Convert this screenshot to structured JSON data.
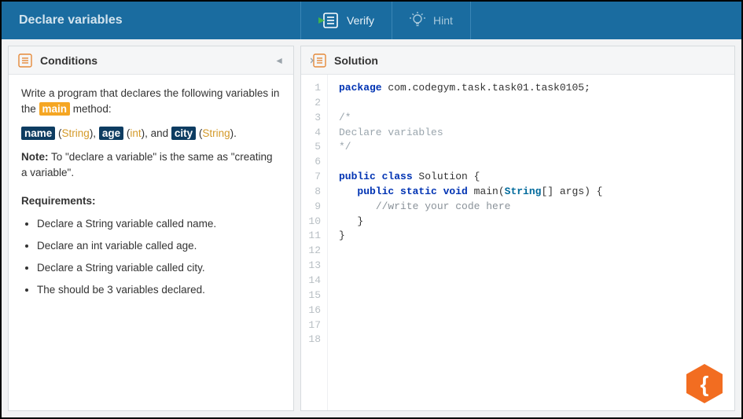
{
  "header": {
    "title": "Declare variables",
    "verify_label": "Verify",
    "hint_label": "Hint"
  },
  "conditions": {
    "panel_title": "Conditions",
    "intro_prefix": "Write a program that declares the following variables in the ",
    "main_tag": "main",
    "intro_suffix": " method:",
    "var1": "name",
    "type1": "String",
    "var2": "age",
    "type2": "int",
    "var3": "city",
    "type3": "String",
    "note_label": "Note:",
    "note_text": " To \"declare a variable\" is the same as \"creating a variable\".",
    "req_heading": "Requirements:",
    "requirements": [
      "Declare a String variable called name.",
      "Declare an int variable called age.",
      "Declare a String variable called city.",
      "The should be 3 variables declared."
    ]
  },
  "solution": {
    "panel_title": "Solution",
    "line_count": 18,
    "code": {
      "l1_kw": "package",
      "l1_pkg": " com.codegym.task.task01.task0105;",
      "l3": "/*",
      "l4": "Declare variables",
      "l5": "*/",
      "l7_a": "public",
      "l7_b": " class",
      "l7_c": " Solution {",
      "l8_a": "public",
      "l8_b": " static",
      "l8_c": " void",
      "l8_d": " main(",
      "l8_e": "String",
      "l8_f": "[] args) {",
      "l9": "//write your code here",
      "l10": "}",
      "l11": "}"
    }
  }
}
